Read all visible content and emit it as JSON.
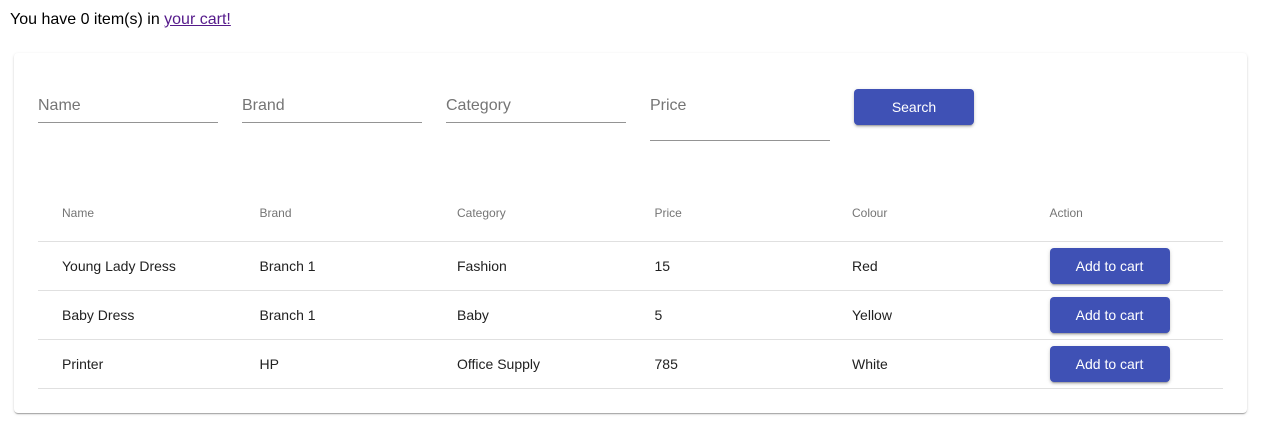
{
  "cart": {
    "prefix": "You have 0 item(s) in ",
    "link_text": "your cart!"
  },
  "search": {
    "name_placeholder": "Name",
    "brand_placeholder": "Brand",
    "category_placeholder": "Category",
    "price_placeholder": "Price",
    "button_label": "Search"
  },
  "table": {
    "headers": [
      "Name",
      "Brand",
      "Category",
      "Price",
      "Colour",
      "Action"
    ],
    "rows": [
      {
        "name": "Young Lady Dress",
        "brand": "Branch 1",
        "category": "Fashion",
        "price": "15",
        "colour": "Red",
        "action": "Add to cart"
      },
      {
        "name": "Baby Dress",
        "brand": "Branch 1",
        "category": "Baby",
        "price": "5",
        "colour": "Yellow",
        "action": "Add to cart"
      },
      {
        "name": "Printer",
        "brand": "HP",
        "category": "Office Supply",
        "price": "785",
        "colour": "White",
        "action": "Add to cart"
      }
    ]
  },
  "colors": {
    "primary": "#3f51b5",
    "link_visited": "#551a8b"
  }
}
